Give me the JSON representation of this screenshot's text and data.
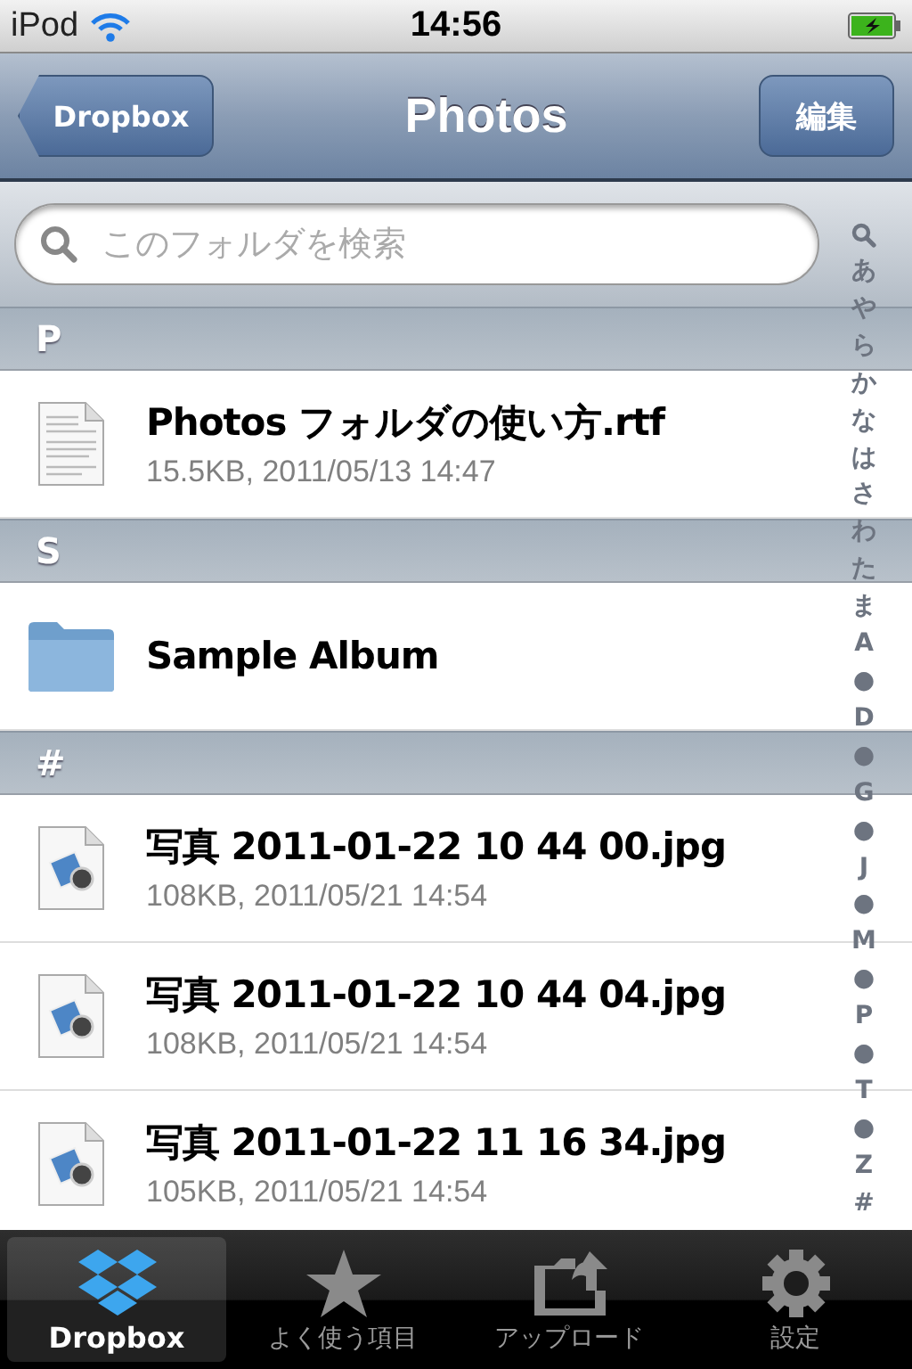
{
  "status_bar": {
    "carrier": "iPod",
    "time": "14:56",
    "charging": true
  },
  "nav_bar": {
    "back": "Dropbox",
    "title": "Photos",
    "edit": "編集"
  },
  "search": {
    "placeholder": "このフォルダを検索"
  },
  "sections": [
    {
      "header": "P",
      "rows": [
        {
          "kind": "document",
          "name": "Photos フォルダの使い方.rtf",
          "detail": "15.5KB, 2011/05/13 14:47"
        }
      ]
    },
    {
      "header": "S",
      "rows": [
        {
          "kind": "folder",
          "name": "Sample Album"
        }
      ]
    },
    {
      "header": "#",
      "rows": [
        {
          "kind": "image",
          "name": "写真 2011-01-22 10 44 00.jpg",
          "detail": "108KB, 2011/05/21 14:54"
        },
        {
          "kind": "image",
          "name": "写真 2011-01-22 10 44 04.jpg",
          "detail": "108KB, 2011/05/21 14:54"
        },
        {
          "kind": "image",
          "name": "写真 2011-01-22 11 16 34.jpg",
          "detail": "105KB, 2011/05/21 14:54"
        }
      ]
    }
  ],
  "index": [
    "あ",
    "や",
    "ら",
    "か",
    "な",
    "は",
    "さ",
    "わ",
    "た",
    "ま",
    "A",
    "●",
    "D",
    "●",
    "G",
    "●",
    "J",
    "●",
    "M",
    "●",
    "P",
    "●",
    "T",
    "●",
    "Z",
    "#"
  ],
  "tab_bar": [
    {
      "kind": "dropbox",
      "label": "Dropbox",
      "selected": true
    },
    {
      "kind": "star",
      "label": "よく使う項目",
      "selected": false
    },
    {
      "kind": "upload",
      "label": "アップロード",
      "selected": false
    },
    {
      "kind": "gear",
      "label": "設定",
      "selected": false
    }
  ]
}
